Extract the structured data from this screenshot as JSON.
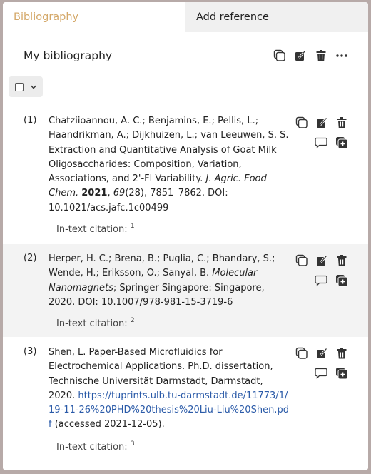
{
  "tabs": [
    {
      "label": "Bibliography",
      "active": true
    },
    {
      "label": "Add reference",
      "active": false
    }
  ],
  "colors": {
    "accent": "#d4a869",
    "link": "#2a5aa8",
    "alt_row": "#f3f3f3"
  },
  "header": {
    "title": "My bibliography",
    "actions": [
      "copy-icon",
      "edit-icon",
      "trash-icon",
      "more-icon"
    ]
  },
  "select_all": {
    "checked": false,
    "icons": [
      "checkbox-icon",
      "chevron-down-icon"
    ]
  },
  "entries": [
    {
      "number": "(1)",
      "authors": "Chatziioannou, A. C.; Benjamins, E.; Pellis, L.; Haandrikman, A.; Dijkhuizen, L.; van Leeuwen, S. S.",
      "title": "Extraction and Quantitative Analysis of Goat Milk Oligosaccharides: Composition, Variation, Associations, and 2'-Fl Variability.",
      "journal": "J. Agric. Food Chem.",
      "year": "2021",
      "volume": "69",
      "rest": "(28), 7851–7862. DOI: 10.1021/acs.jafc.1c00499",
      "intext_label": "In-text citation:",
      "intext_num": "1"
    },
    {
      "number": "(2)",
      "authors": "Herper, H. C.; Brena, B.; Puglia, C.; Bhandary, S.; Wende, H.; Eriksson, O.; Sanyal, B.",
      "book": "Molecular Nanomagnets",
      "rest": "; Springer Singapore: Singapore, 2020. DOI: 10.1007/978-981-15-3719-6",
      "intext_label": "In-text citation:",
      "intext_num": "2"
    },
    {
      "number": "(3)",
      "text": "Shen, L. Paper-Based Microfluidics for Electrochemical Applications. Ph.D. dissertation, Technische Universität Darmstadt, Darmstadt, 2020.",
      "url": "https://tuprints.ulb.tu-darmstadt.de/11773/1/19-11-26%20PHD%20thesis%20Liu-Liu%20Shen.pdf",
      "accessed": "(accessed 2021-12-05).",
      "intext_label": "In-text citation:",
      "intext_num": "3"
    }
  ],
  "entry_actions": [
    "copy-icon",
    "edit-icon",
    "trash-icon",
    "comment-icon",
    "add-copy-icon"
  ]
}
